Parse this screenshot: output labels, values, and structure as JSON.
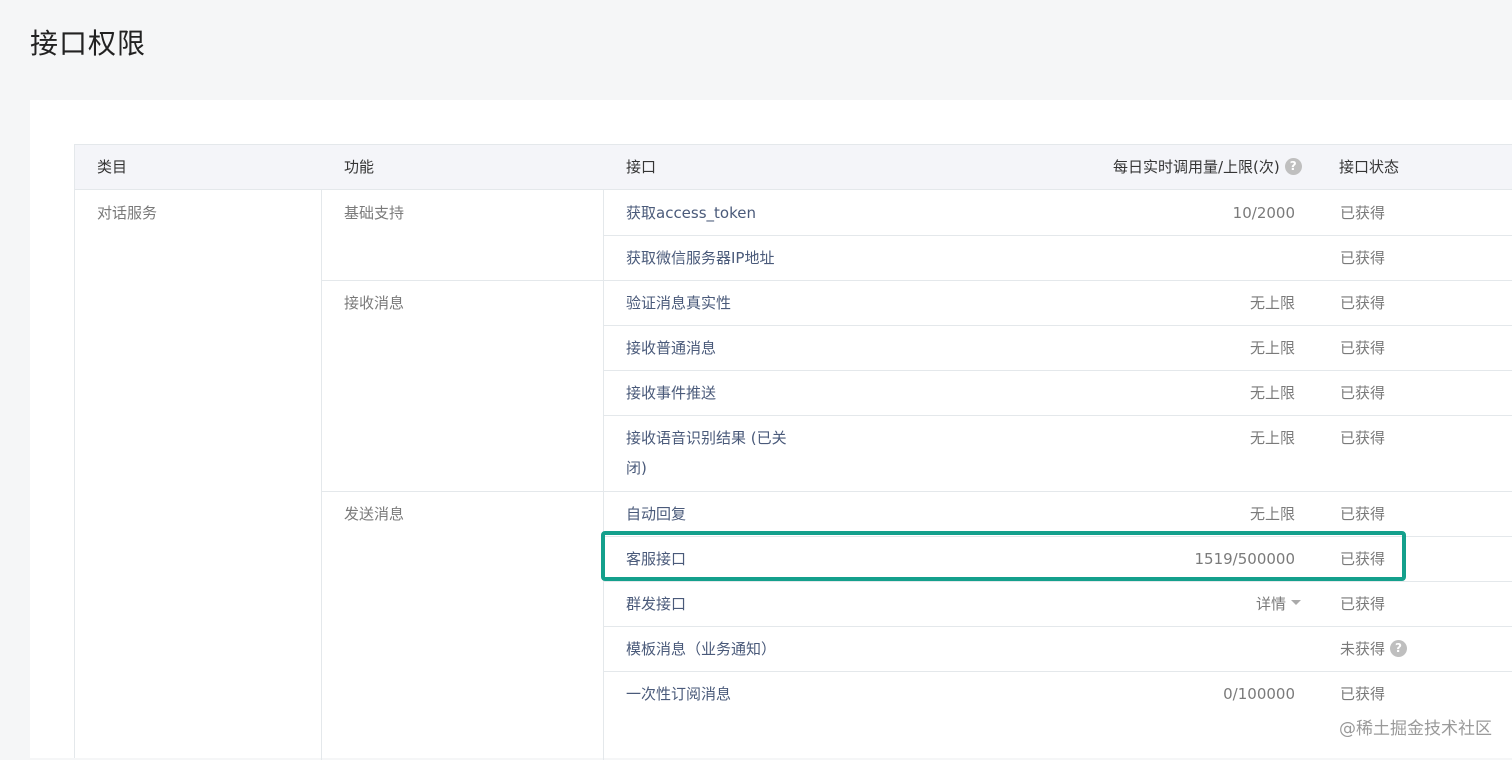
{
  "page": {
    "title": "接口权限"
  },
  "table": {
    "headers": {
      "category": "类目",
      "function": "功能",
      "interface": "接口",
      "usage": "每日实时调用量/上限(次)",
      "status": "接口状态"
    },
    "category": "对话服务",
    "groups": [
      {
        "label": "基础支持"
      },
      {
        "label": "接收消息"
      },
      {
        "label": "发送消息"
      }
    ],
    "rows": [
      {
        "name": "获取access_token",
        "usage": "10/2000",
        "status": "已获得"
      },
      {
        "name": "获取微信服务器IP地址",
        "usage": "",
        "status": "已获得"
      },
      {
        "name": "验证消息真实性",
        "usage": "无上限",
        "status": "已获得"
      },
      {
        "name": "接收普通消息",
        "usage": "无上限",
        "status": "已获得"
      },
      {
        "name": "接收事件推送",
        "usage": "无上限",
        "status": "已获得"
      },
      {
        "name": "接收语音识别结果 (已关闭)",
        "name_line1": "接收语音识别结果 (已关",
        "name_line2": "闭)",
        "usage": "无上限",
        "status": "已获得"
      },
      {
        "name": "自动回复",
        "usage": "无上限",
        "status": "已获得"
      },
      {
        "name": "客服接口",
        "usage": "1519/500000",
        "status": "已获得"
      },
      {
        "name": "群发接口",
        "usage": "详情",
        "status": "已获得"
      },
      {
        "name": "模板消息（业务通知）",
        "usage": "",
        "status": "未获得"
      },
      {
        "name": "一次性订阅消息",
        "usage": "0/100000",
        "status": "已获得"
      }
    ]
  },
  "highlight_color": "#14a08c",
  "watermark": "@稀土掘金技术社区",
  "icons": {
    "help": "question-circle-icon",
    "caret": "caret-down-icon"
  }
}
